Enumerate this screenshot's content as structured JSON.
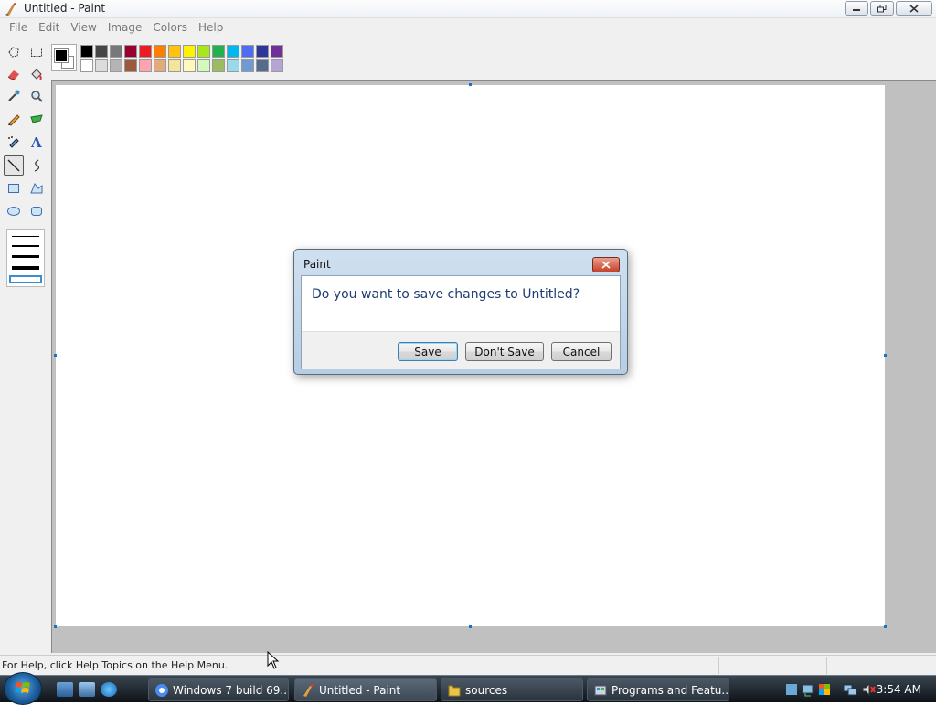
{
  "window": {
    "title": "Untitled - Paint"
  },
  "menu": [
    "File",
    "Edit",
    "View",
    "Image",
    "Colors",
    "Help"
  ],
  "toolbox": {
    "selected_tool": "line",
    "tools": [
      "free-form-select",
      "select",
      "eraser",
      "fill-with-color",
      "pick-color",
      "magnifier",
      "pencil",
      "brush",
      "airbrush",
      "text",
      "line",
      "curve",
      "rectangle",
      "polygon",
      "ellipse",
      "rounded-rectangle"
    ]
  },
  "palette": {
    "foreground": "#000000",
    "background": "#ffffff",
    "row1": [
      "#000000",
      "#464646",
      "#787878",
      "#990030",
      "#ed1c24",
      "#ff7e00",
      "#ffc20e",
      "#fff200",
      "#a8e61d",
      "#22b14c",
      "#00b7ef",
      "#4d6df3",
      "#2f3699",
      "#6f3198"
    ],
    "row2": [
      "#ffffff",
      "#dcdcdc",
      "#b4b4b4",
      "#9c5a3c",
      "#ffa3b1",
      "#e5aa7a",
      "#f5e49c",
      "#fff9bd",
      "#d3f9bc",
      "#9dbb61",
      "#99d9ea",
      "#709ad1",
      "#546d8e",
      "#b5a5d5"
    ]
  },
  "status": {
    "message": "For Help, click Help Topics on the Help Menu."
  },
  "dialog": {
    "title": "Paint",
    "message": "Do you want to save changes to Untitled?",
    "buttons": {
      "save": "Save",
      "dont_save": "Don't Save",
      "cancel": "Cancel"
    }
  },
  "taskbar": {
    "tasks": [
      {
        "label": "Windows 7 build 69...",
        "icon": "chrome-icon"
      },
      {
        "label": "Untitled - Paint",
        "icon": "paint-icon"
      },
      {
        "label": "sources",
        "icon": "folder-icon"
      },
      {
        "label": "Programs and Featu...",
        "icon": "control-panel-icon"
      }
    ],
    "clock": "3:54 AM"
  }
}
